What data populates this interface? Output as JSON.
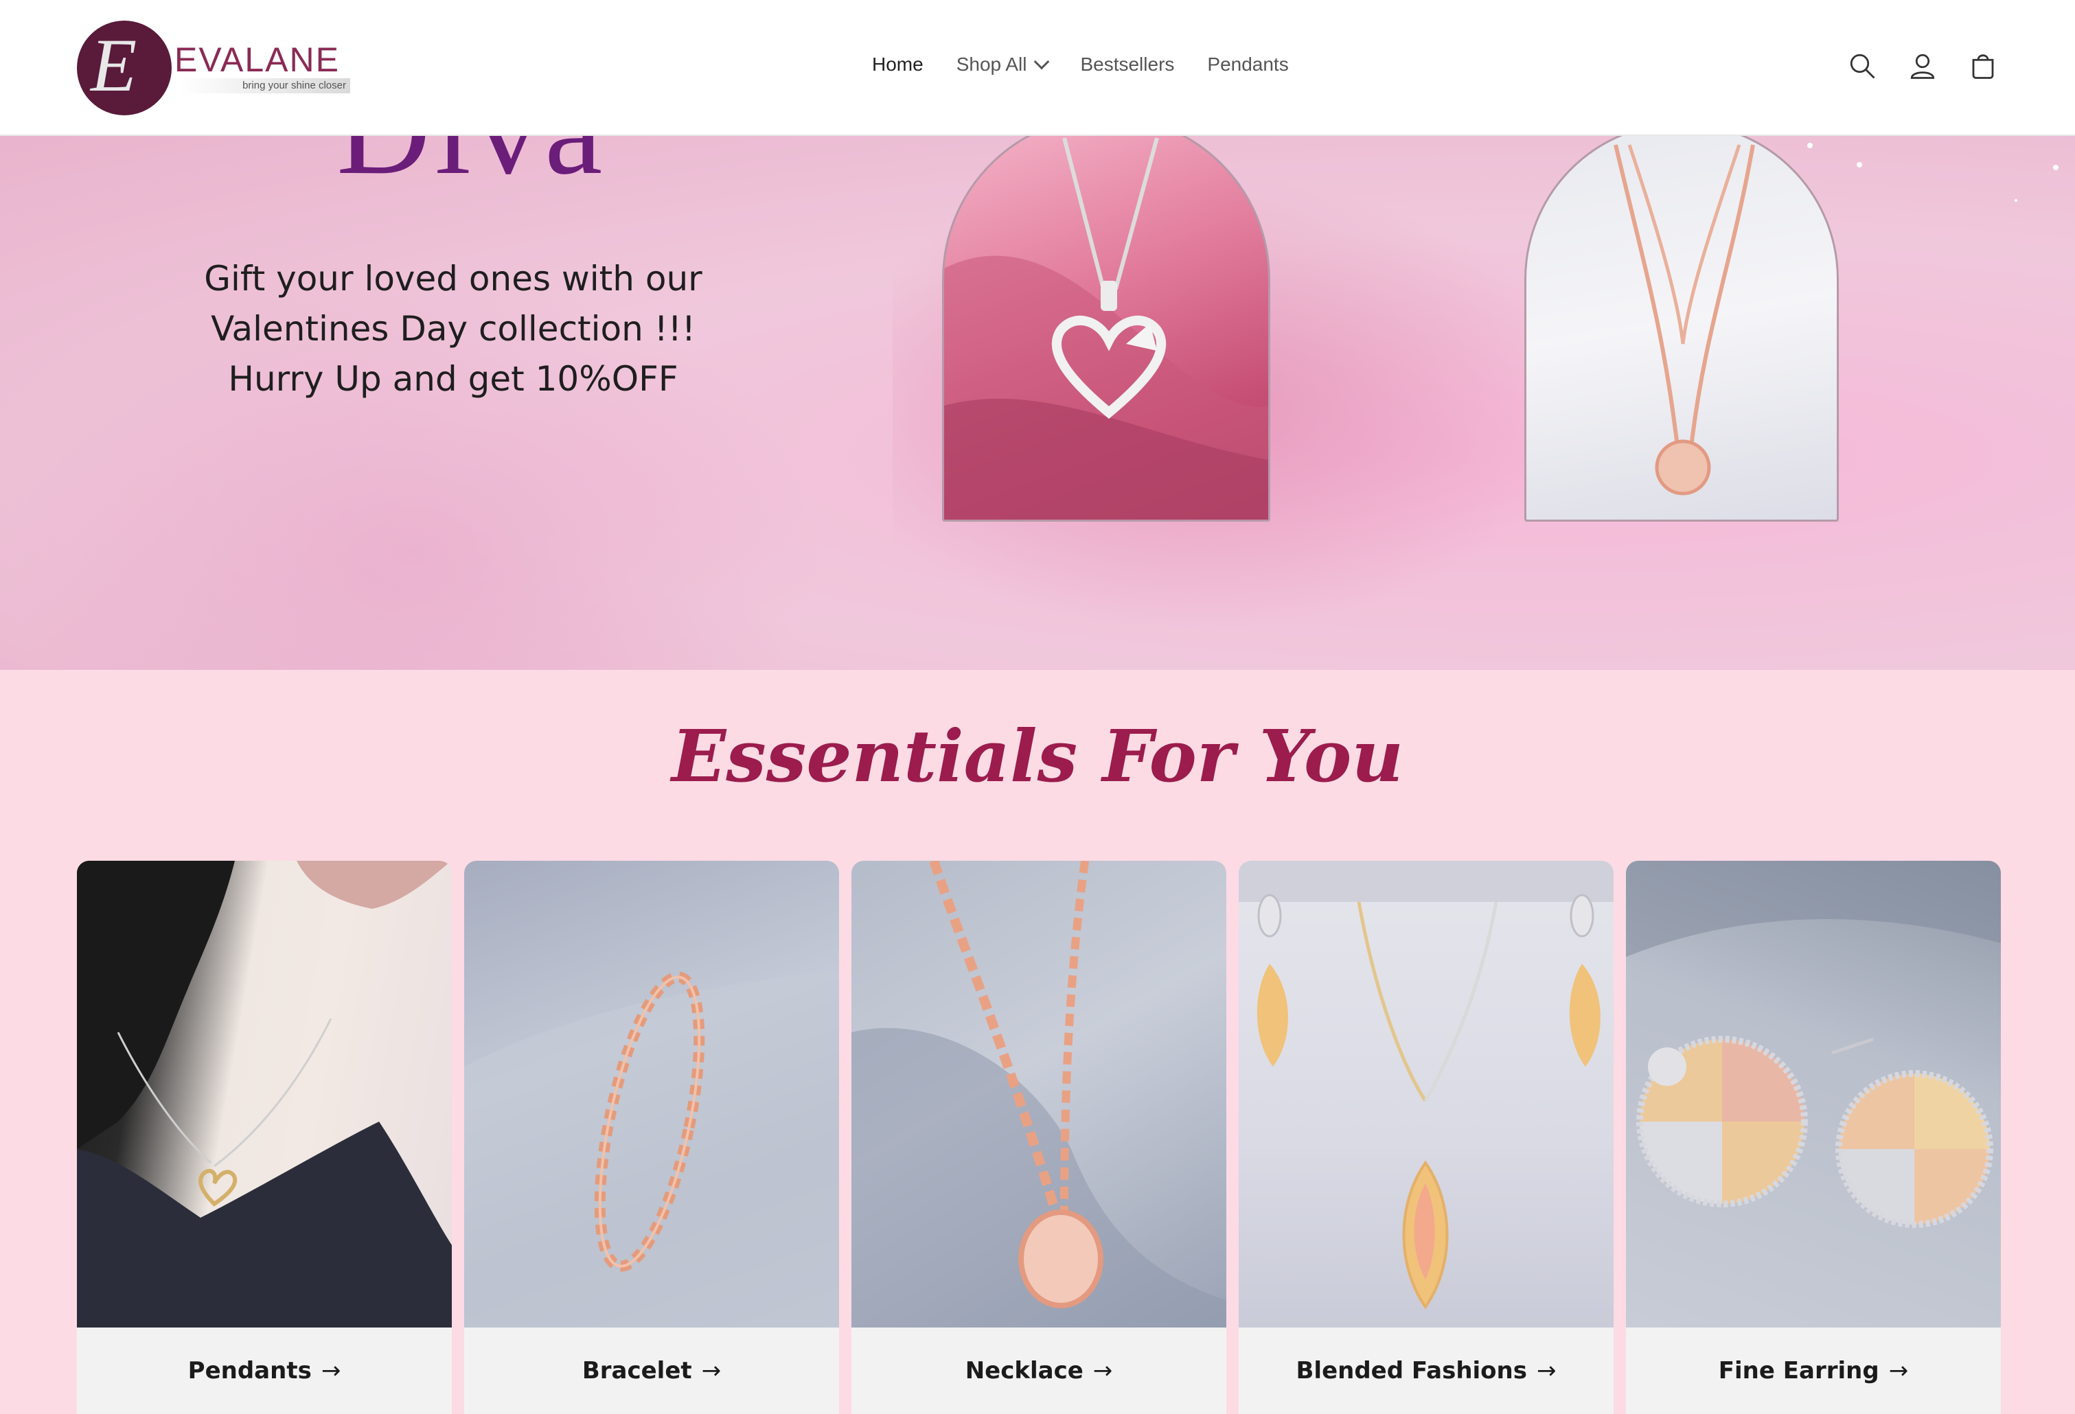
{
  "brand": {
    "mark": "E",
    "name": "EVALANE",
    "tagline": "bring your shine closer"
  },
  "nav": {
    "items": [
      "Home",
      "Shop All",
      "Bestsellers",
      "Pendants"
    ]
  },
  "banner": {
    "headline": "Diva",
    "promo": "Gift your loved ones with our Valentines Day collection !!! Hurry Up and get 10%OFF"
  },
  "essentials": {
    "title": "Essentials For You",
    "categories": [
      {
        "label": "Pendants"
      },
      {
        "label": "Bracelet"
      },
      {
        "label": "Necklace"
      },
      {
        "label": "Blended Fashions"
      },
      {
        "label": "Fine Earring"
      }
    ]
  },
  "colors": {
    "accent": "#9b1c4d",
    "headline": "#6b1d7a",
    "page_bg": "#fcdbe4",
    "logo": "#5a1a3a"
  },
  "icons": [
    "search-icon",
    "account-icon",
    "cart-icon",
    "arrow-right-icon",
    "chevron-down-icon"
  ]
}
